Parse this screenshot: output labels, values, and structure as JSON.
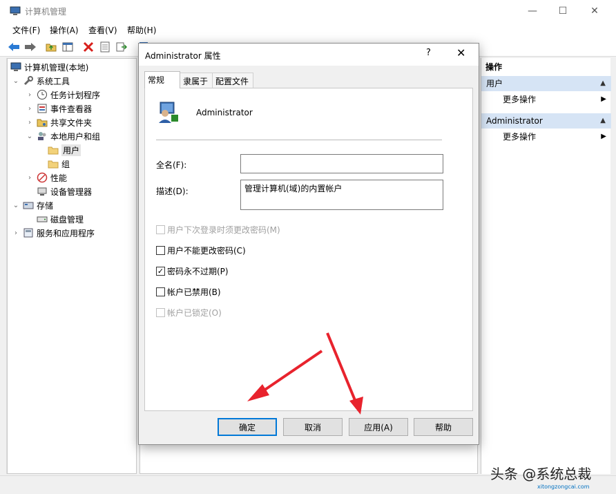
{
  "window": {
    "title": "计算机管理",
    "controls": [
      "—",
      "☐",
      "✕"
    ]
  },
  "menu": [
    "文件(F)",
    "操作(A)",
    "查看(V)",
    "帮助(H)"
  ],
  "tree": {
    "root": "计算机管理(本地)",
    "items": [
      {
        "label": "系统工具"
      },
      {
        "label": "任务计划程序"
      },
      {
        "label": "事件查看器"
      },
      {
        "label": "共享文件夹"
      },
      {
        "label": "本地用户和组"
      },
      {
        "label": "用户"
      },
      {
        "label": "组"
      },
      {
        "label": "性能"
      },
      {
        "label": "设备管理器"
      },
      {
        "label": "存储"
      },
      {
        "label": "磁盘管理"
      },
      {
        "label": "服务和应用程序"
      }
    ]
  },
  "actions": {
    "header": "操作",
    "sections": [
      {
        "title": "用户",
        "item": "更多操作"
      },
      {
        "title": "Administrator",
        "item": "更多操作"
      }
    ]
  },
  "dialog": {
    "title": "Administrator 属性",
    "help": "?",
    "close": "✕",
    "tabs": [
      "常规",
      "隶属于",
      "配置文件"
    ],
    "username": "Administrator",
    "fullname_label": "全名(F):",
    "fullname_value": "",
    "desc_label": "描述(D):",
    "desc_value": "管理计算机(域)的内置帐户",
    "checkboxes": [
      {
        "label": "用户下次登录时须更改密码(M)",
        "checked": false,
        "disabled": true
      },
      {
        "label": "用户不能更改密码(C)",
        "checked": false,
        "disabled": false
      },
      {
        "label": "密码永不过期(P)",
        "checked": true,
        "disabled": false
      },
      {
        "label": "帐户已禁用(B)",
        "checked": false,
        "disabled": false
      },
      {
        "label": "帐户已锁定(O)",
        "checked": false,
        "disabled": true
      }
    ],
    "buttons": {
      "ok": "确定",
      "cancel": "取消",
      "apply": "应用(A)",
      "help": "帮助"
    }
  },
  "watermark": {
    "text": "头条 @系统总裁",
    "site": "xitongzongcai.com"
  },
  "colors": {
    "accent": "#0078d7",
    "arrow": "#e8232d",
    "section_bg": "#d6e4f5"
  }
}
